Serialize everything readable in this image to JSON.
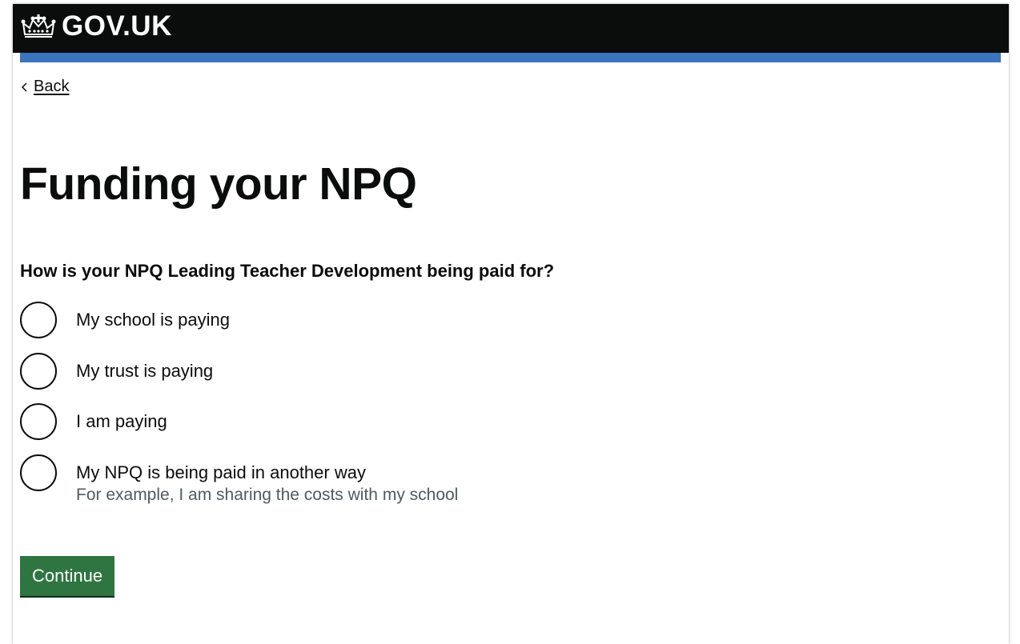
{
  "header": {
    "logo_text": "GOV.UK",
    "background_color": "#0b0c0c",
    "stripe_color": "#3b75bd",
    "logo_icon": "crown-icon"
  },
  "back_link": {
    "label": "Back",
    "icon": "chevron-left-icon"
  },
  "page": {
    "title": "Funding your NPQ"
  },
  "form": {
    "question": "How is your NPQ Leading Teacher Development being paid for?",
    "options": [
      {
        "label": "My school is paying",
        "hint": ""
      },
      {
        "label": "My trust is paying",
        "hint": ""
      },
      {
        "label": "I am paying",
        "hint": ""
      },
      {
        "label": "My NPQ is being paid in another way",
        "hint": "For example, I am sharing the costs with my school"
      }
    ],
    "selected": null,
    "continue_label": "Continue",
    "button_color": "#2e7541"
  }
}
